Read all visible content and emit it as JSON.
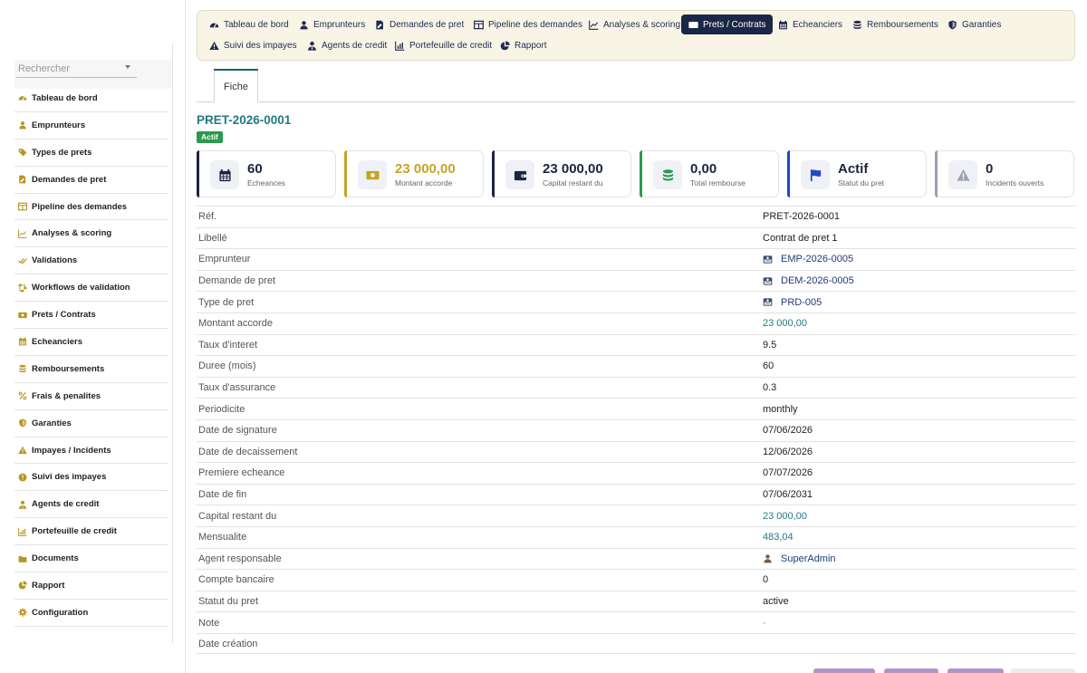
{
  "search": {
    "placeholder": "Rechercher"
  },
  "sidebar": {
    "items": [
      {
        "label": "Tableau de bord",
        "icon": "gauge-icon"
      },
      {
        "label": "Emprunteurs",
        "icon": "user-icon"
      },
      {
        "label": "Types de prets",
        "icon": "tags-icon"
      },
      {
        "label": "Demandes de pret",
        "icon": "file-signature-icon"
      },
      {
        "label": "Pipeline des demandes",
        "icon": "columns-icon"
      },
      {
        "label": "Analyses & scoring",
        "icon": "chart-line-icon"
      },
      {
        "label": "Validations",
        "icon": "check-double-icon"
      },
      {
        "label": "Workflows de validation",
        "icon": "project-diagram-icon"
      },
      {
        "label": "Prets / Contrats",
        "icon": "money-bill-icon"
      },
      {
        "label": "Echeanciers",
        "icon": "calendar-icon"
      },
      {
        "label": "Remboursements",
        "icon": "coins-icon"
      },
      {
        "label": "Frais & penalites",
        "icon": "percent-icon"
      },
      {
        "label": "Garanties",
        "icon": "shield-icon"
      },
      {
        "label": "Impayes / Incidents",
        "icon": "warning-icon"
      },
      {
        "label": "Suivi des impayes",
        "icon": "alert-circle-icon"
      },
      {
        "label": "Agents de credit",
        "icon": "user-tie-icon"
      },
      {
        "label": "Portefeuille de credit",
        "icon": "chart-area-icon"
      },
      {
        "label": "Documents",
        "icon": "folder-icon"
      },
      {
        "label": "Rapport",
        "icon": "chart-pie-icon"
      },
      {
        "label": "Configuration",
        "icon": "gear-icon"
      }
    ]
  },
  "topmenu": {
    "items": [
      {
        "label": "Tableau de bord",
        "icon": "gauge-icon"
      },
      {
        "label": "Emprunteurs",
        "icon": "user-icon"
      },
      {
        "label": "Demandes de pret",
        "icon": "file-signature-icon"
      },
      {
        "label": "Pipeline des demandes",
        "icon": "columns-icon"
      },
      {
        "label": "Analyses & scoring",
        "icon": "chart-line-icon"
      },
      {
        "label": "Prets / Contrats",
        "icon": "money-bill-icon"
      },
      {
        "label": "Echeanciers",
        "icon": "calendar-icon"
      },
      {
        "label": "Remboursements",
        "icon": "coins-icon"
      },
      {
        "label": "Garanties",
        "icon": "shield-icon"
      },
      {
        "label": "Suivi des impayes",
        "icon": "warning-icon"
      },
      {
        "label": "Agents de credit",
        "icon": "user-tie-icon"
      },
      {
        "label": "Portefeuille de credit",
        "icon": "chart-area-icon"
      },
      {
        "label": "Rapport",
        "icon": "chart-pie-icon"
      }
    ],
    "active": "Prets / Contrats"
  },
  "tabs": [
    {
      "label": "Fiche"
    }
  ],
  "record": {
    "ref": "PRET-2026-0001",
    "status_badge": "Actif"
  },
  "kpis": [
    {
      "value": "60",
      "label": "Echeances",
      "icon": "calendar-icon",
      "accent": "#1c2440"
    },
    {
      "value": "23 000,00",
      "label": "Montant accorde",
      "icon": "money-bill-icon",
      "accent": "#c9a227"
    },
    {
      "value": "23 000,00",
      "label": "Capital restant du",
      "icon": "wallet-icon",
      "accent": "#1c2440"
    },
    {
      "value": "0,00",
      "label": "Total rembourse",
      "icon": "coins-icon",
      "accent": "#2b9a4d"
    },
    {
      "value": "Actif",
      "label": "Statut du pret",
      "icon": "flag-icon",
      "accent": "#2347c5"
    },
    {
      "value": "0",
      "label": "Incidents ouverts",
      "icon": "warning-icon",
      "accent": "#9aa0b0"
    }
  ],
  "details": [
    {
      "label": "Réf.",
      "value": "PRET-2026-0001"
    },
    {
      "label": "Libellé",
      "value": "Contrat de pret 1"
    },
    {
      "label": "Emprunteur",
      "value": "EMP-2026-0005",
      "kind": "link"
    },
    {
      "label": "Demande de pret",
      "value": "DEM-2026-0005",
      "kind": "link"
    },
    {
      "label": "Type de pret",
      "value": "PRD-005",
      "kind": "link"
    },
    {
      "label": "Montant accorde",
      "value": "23 000,00",
      "kind": "amount"
    },
    {
      "label": "Taux d'interet",
      "value": "9.5"
    },
    {
      "label": "Duree (mois)",
      "value": "60"
    },
    {
      "label": "Taux d'assurance",
      "value": "0.3"
    },
    {
      "label": "Periodicite",
      "value": "monthly"
    },
    {
      "label": "Date de signature",
      "value": "07/06/2026"
    },
    {
      "label": "Date de decaissement",
      "value": "12/06/2026"
    },
    {
      "label": "Premiere echeance",
      "value": "07/07/2026"
    },
    {
      "label": "Date de fin",
      "value": "07/06/2031"
    },
    {
      "label": "Capital restant du",
      "value": "23 000,00",
      "kind": "amount"
    },
    {
      "label": "Mensualite",
      "value": "483,04",
      "kind": "amount"
    },
    {
      "label": "Agent responsable",
      "value": "SuperAdmin",
      "kind": "user"
    },
    {
      "label": "Compte bancaire",
      "value": "0"
    },
    {
      "label": "Statut du pret",
      "value": "active"
    },
    {
      "label": "Note",
      "value": "-",
      "kind": "muted"
    },
    {
      "label": "Date création",
      "value": ""
    }
  ],
  "colors": {
    "accent_teal": "#227a7f",
    "nav_dark": "#1b2746",
    "badge_green": "#2b9a4d",
    "menu_bg": "#f8f5e6",
    "button_purple": "#b195c9"
  }
}
